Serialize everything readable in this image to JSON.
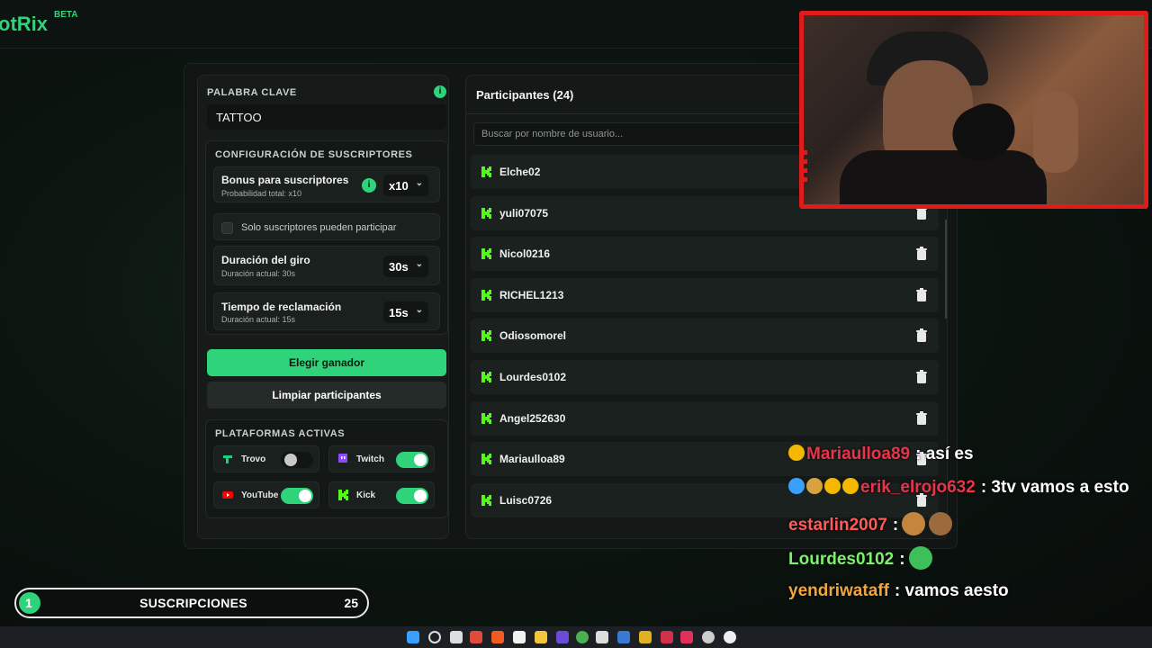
{
  "brand": {
    "name": "otRix",
    "badge": "BETA"
  },
  "keyword": {
    "title": "PALABRA CLAVE",
    "value": "TATTOO"
  },
  "subscriber_config": {
    "title": "CONFIGURACIÓN DE SUSCRIPTORES",
    "bonus": {
      "title": "Bonus para suscriptores",
      "subtitle": "Probabilidad total: x10",
      "value": "x10"
    },
    "only_subs": {
      "label": "Solo suscriptores pueden participar",
      "checked": false
    },
    "duration": {
      "title": "Duración del giro",
      "subtitle": "Duración actual: 30s",
      "value": "30s"
    },
    "claim": {
      "title": "Tiempo de reclamación",
      "subtitle": "Duración actual: 15s",
      "value": "15s"
    }
  },
  "actions": {
    "pick_winner": "Elegir ganador",
    "clear": "Limpiar participantes"
  },
  "platforms": {
    "title": "PLATAFORMAS ACTIVAS",
    "items": [
      {
        "name": "Trovo",
        "enabled": false,
        "icon": "trovo-icon",
        "color": "#19d27b"
      },
      {
        "name": "Twitch",
        "enabled": true,
        "icon": "twitch-icon",
        "color": "#9146ff"
      },
      {
        "name": "YouTube",
        "enabled": true,
        "icon": "youtube-icon",
        "color": "#ff0000"
      },
      {
        "name": "Kick",
        "enabled": true,
        "icon": "kick-icon",
        "color": "#53fc18"
      }
    ]
  },
  "participants": {
    "title": "Participantes (24)",
    "search_placeholder": "Buscar por nombre de usuario...",
    "rows": [
      "Elche02",
      "yuli07075",
      "Nicol0216",
      "RICHEL1213",
      "Odiosomorel",
      "Lourdes0102",
      "Angel252630",
      "Mariaulloa89",
      "Luisc0726"
    ]
  },
  "chat": [
    {
      "user": "Mariaulloa89",
      "text": ": así es",
      "color": "#e8344a",
      "badges": [
        "gold-1"
      ]
    },
    {
      "user": "erik_elrojo632",
      "text": ": 3tv vamos a esto",
      "color": "#e8344a",
      "badges": [
        "hammer",
        "diamond",
        "gold-1",
        "crown"
      ]
    },
    {
      "user": "estarlin2007",
      "text": ":",
      "color": "#ff5a5a",
      "badges": [],
      "emotes": [
        "emote-1",
        "emote-kekw"
      ]
    },
    {
      "user": "Lourdes0102",
      "text": ":",
      "color": "#7cf26b",
      "badges": [],
      "emotes": [
        "emote-alien"
      ]
    },
    {
      "user": "yendriwataff",
      "text": ": vamos aesto",
      "color": "#f0a640",
      "badges": []
    }
  ],
  "sub_goal": {
    "label": "SUSCRIPCIONES",
    "current": "1",
    "goal": "25"
  },
  "colors": {
    "accent": "#2fd37a",
    "webcam_border": "#e01b1b"
  }
}
